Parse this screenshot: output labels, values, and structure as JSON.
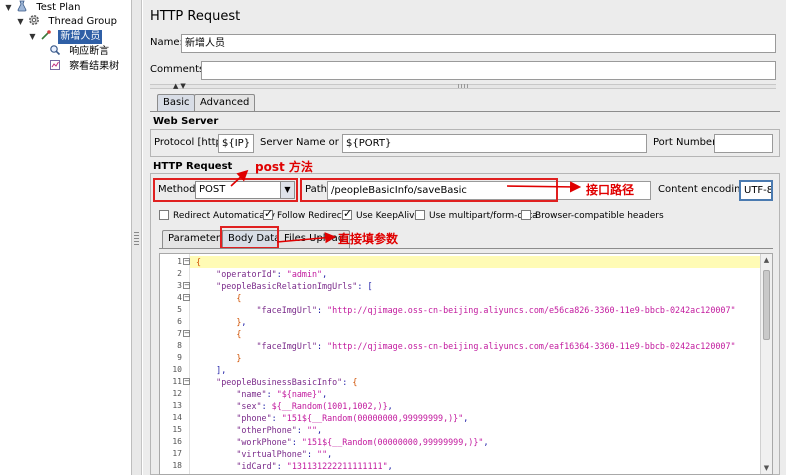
{
  "tree": [
    {
      "label": "Test Plan",
      "icon": "test-plan-icon"
    },
    {
      "label": "Thread Group",
      "icon": "gear-icon"
    },
    {
      "label": "新增人员",
      "icon": "pipette-icon"
    },
    {
      "label": "响应断言",
      "icon": "magnifier-icon"
    },
    {
      "label": "察看结果树",
      "icon": "chart-icon"
    }
  ],
  "panel": {
    "title": "HTTP Request",
    "name_label": "Name:",
    "name_value": "新增人员",
    "comments_label": "Comments:",
    "comments_value": ""
  },
  "tabs": {
    "basic": "Basic",
    "advanced": "Advanced"
  },
  "webserver": {
    "title": "Web Server",
    "protocol_label": "Protocol [http]:",
    "protocol_value": "${IP}",
    "server_label": "Server Name or IP:",
    "server_value": "${PORT}",
    "port_label": "Port Number:",
    "port_value": ""
  },
  "httpreq": {
    "title": "HTTP Request",
    "method_label": "Method:",
    "method_value": "POST",
    "path_label": "Path:",
    "path_value": "/peopleBasicInfo/saveBasic",
    "encoding_label": "Content encoding:",
    "encoding_value": "UTF-8"
  },
  "checkboxes": [
    {
      "label": "Redirect Automatically",
      "checked": false
    },
    {
      "label": "Follow Redirects",
      "checked": true
    },
    {
      "label": "Use KeepAlive",
      "checked": true
    },
    {
      "label": "Use multipart/form-data",
      "checked": false
    },
    {
      "label": "Browser-compatible headers",
      "checked": false
    }
  ],
  "subtabs": {
    "parameters": "Parameters",
    "body": "Body Data",
    "files": "Files Upload"
  },
  "annotations": {
    "post": "post 方法",
    "path": "接口路径",
    "body": "直接填参数"
  },
  "editor": {
    "line_numbers": [
      "1",
      "2",
      "3",
      "4",
      "5",
      "6",
      "7",
      "8",
      "9",
      "10",
      "11",
      "12",
      "13",
      "14",
      "15",
      "16",
      "17",
      "18"
    ],
    "lines": [
      "{",
      "    \"operatorId\": \"admin\",",
      "    \"peopleBasicRelationImgUrls\": [",
      "        {",
      "            \"faceImgUrl\": \"http://qjimage.oss-cn-beijing.aliyuncs.com/e56ca826-3360-11e9-bbcb-0242ac120007\"",
      "        },",
      "        {",
      "            \"faceImgUrl\": \"http://qjimage.oss-cn-beijing.aliyuncs.com/eaf16364-3360-11e9-bbcb-0242ac120007\"",
      "        }",
      "    ],",
      "    \"peopleBusinessBasicInfo\": {",
      "        \"name\": \"${name}\",",
      "        \"sex\": ${__Random(1001,1002,)},",
      "        \"phone\": \"151${__Random(00000000,99999999,)}\",",
      "        \"otherPhone\": \"\",",
      "        \"workPhone\": \"151${__Random(00000000,99999999,)}\",",
      "        \"virtualPhone\": \"\",",
      "        \"idCard\": \"131131222211111111\","
    ],
    "fold_lines": [
      1,
      3,
      4,
      7,
      11
    ]
  }
}
